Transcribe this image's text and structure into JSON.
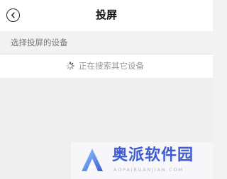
{
  "header": {
    "title": "投屏",
    "back_icon": "chevron-left-circle-icon"
  },
  "section": {
    "label": "选择投屏的设备"
  },
  "search": {
    "status_text": "正在搜索其它设备",
    "spinner_icon": "loading-spinner-icon"
  },
  "watermark": {
    "text": "奥派软件园",
    "subtext": "AOPAIRUANJIAN.COM",
    "brand_color": "#3f5bd1"
  }
}
